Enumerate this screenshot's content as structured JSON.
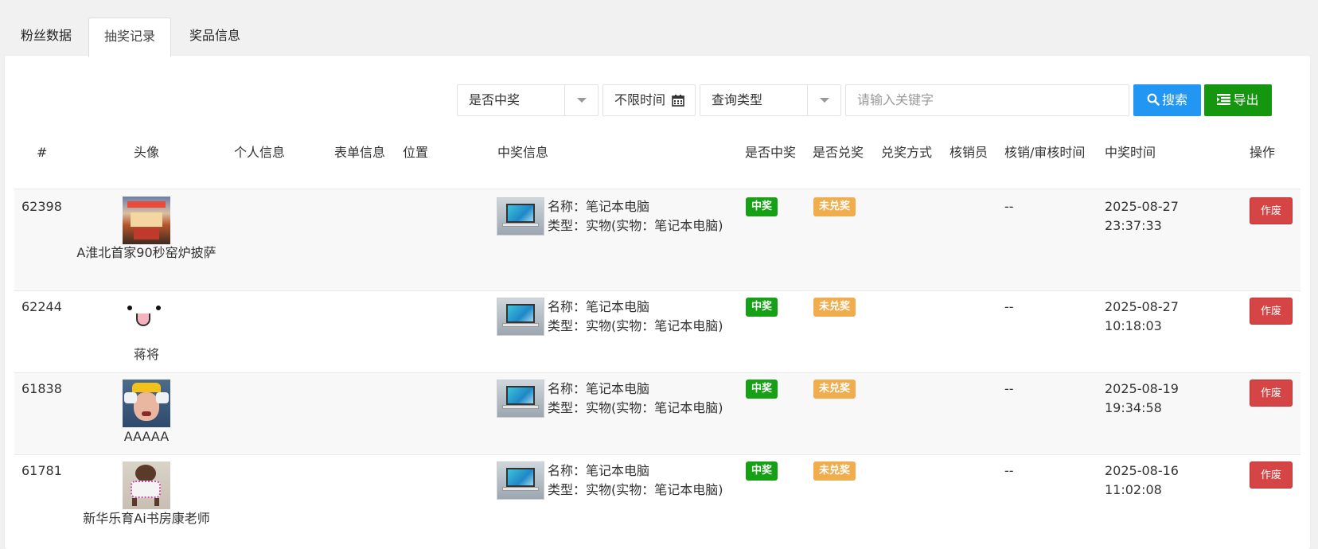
{
  "tabs": [
    {
      "label": "粉丝数据"
    },
    {
      "label": "抽奖记录"
    },
    {
      "label": "奖品信息"
    }
  ],
  "filters": {
    "win_select": "是否中奖",
    "time_select": "不限时间",
    "query_type": "查询类型",
    "keyword_placeholder": "请输入关键字",
    "search_label": "搜索",
    "export_label": "导出"
  },
  "columns": [
    "#",
    "头像",
    "个人信息",
    "表单信息",
    "位置",
    "中奖信息",
    "是否中奖",
    "是否兑奖",
    "兑奖方式",
    "核销员",
    "核销/审核时间",
    "中奖时间",
    "操作"
  ],
  "rows": [
    {
      "id": "62398",
      "nickname": "A淮北首家90秒窑炉披萨",
      "prize_name": "名称：笔记本电脑",
      "prize_type": "类型：实物(实物：笔记本电脑)",
      "win_badge": "中奖",
      "redeem_badge": "未兑奖",
      "verify_time": "--",
      "win_date": "2025-08-27",
      "win_clock": "23:37:33",
      "action": "作废"
    },
    {
      "id": "62244",
      "nickname": "蒋将",
      "prize_name": "名称：笔记本电脑",
      "prize_type": "类型：实物(实物：笔记本电脑)",
      "win_badge": "中奖",
      "redeem_badge": "未兑奖",
      "verify_time": "--",
      "win_date": "2025-08-27",
      "win_clock": "10:18:03",
      "action": "作废"
    },
    {
      "id": "61838",
      "nickname": "AAAAA",
      "prize_name": "名称：笔记本电脑",
      "prize_type": "类型：实物(实物：笔记本电脑)",
      "win_badge": "中奖",
      "redeem_badge": "未兑奖",
      "verify_time": "--",
      "win_date": "2025-08-19",
      "win_clock": "19:34:58",
      "action": "作废"
    },
    {
      "id": "61781",
      "nickname": "新华乐育Ai书房康老师",
      "prize_name": "名称：笔记本电脑",
      "prize_type": "类型：实物(实物：笔记本电脑)",
      "win_badge": "中奖",
      "redeem_badge": "未兑奖",
      "verify_time": "--",
      "win_date": "2025-08-16",
      "win_clock": "11:02:08",
      "action": "作废"
    }
  ],
  "colors": {
    "primary": "#2196f3",
    "export": "#14960f",
    "win": "#15a015",
    "pending": "#f0ad4e",
    "danger": "#d54545"
  },
  "icons": {
    "calendar": "calendar-icon",
    "search": "search-icon",
    "export": "list-icon",
    "dropdown": "chevron-down-icon"
  }
}
